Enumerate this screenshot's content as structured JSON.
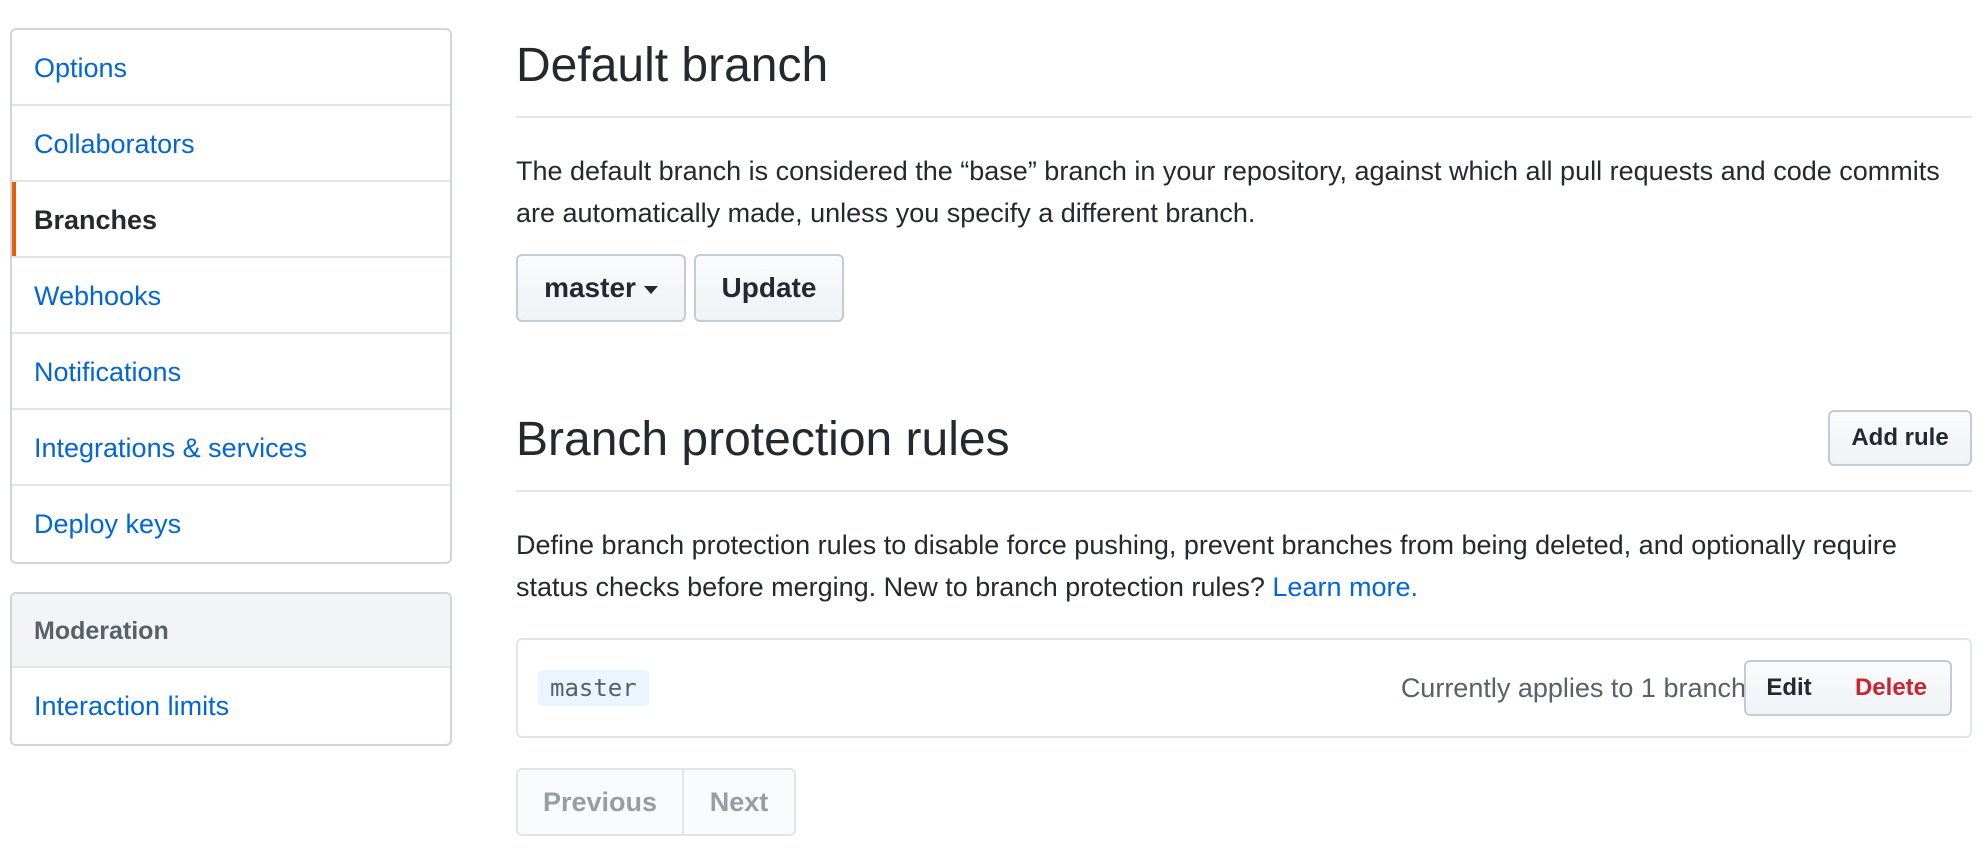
{
  "sidebar": {
    "items": [
      {
        "label": "Options"
      },
      {
        "label": "Collaborators"
      },
      {
        "label": "Branches"
      },
      {
        "label": "Webhooks"
      },
      {
        "label": "Notifications"
      },
      {
        "label": "Integrations & services"
      },
      {
        "label": "Deploy keys"
      }
    ],
    "selected": "Branches",
    "moderation": {
      "heading": "Moderation",
      "items": [
        {
          "label": "Interaction limits"
        }
      ]
    }
  },
  "default_branch": {
    "title": "Default branch",
    "description": "The default branch is considered the “base” branch in your repository, against which all pull requests and code commits are automatically made, unless you specify a different branch.",
    "branch_select": "master",
    "update_label": "Update"
  },
  "protection": {
    "title": "Branch protection rules",
    "add_rule_label": "Add rule",
    "description": "Define branch protection rules to disable force pushing, prevent branches from being deleted, and optionally require status checks before merging. New to branch protection rules?",
    "learn_more": "Learn more.",
    "rules": [
      {
        "branch": "master",
        "applies": "Currently applies to 1 branch",
        "edit_label": "Edit",
        "delete_label": "Delete"
      }
    ],
    "pagination": {
      "previous": "Previous",
      "next": "Next"
    }
  },
  "colors": {
    "link": "#0366d6",
    "selected_indicator": "#e36209",
    "danger": "#cb2431"
  }
}
